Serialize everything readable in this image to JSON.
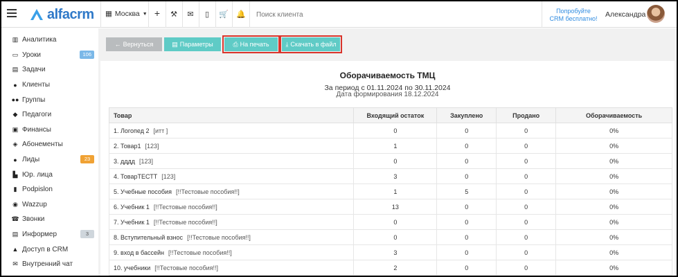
{
  "brand": {
    "name": "alfacrm"
  },
  "topbar": {
    "city": "Москва",
    "search_placeholder": "Поиск клиента",
    "promo_line1": "Попробуйте",
    "promo_line2": "CRM бесплатно!",
    "user_name": "Александра"
  },
  "sidebar": {
    "items": [
      {
        "label": "Аналитика",
        "icon": "chart-icon"
      },
      {
        "label": "Уроки",
        "icon": "calendar-icon",
        "badge": "106",
        "badge_color": "#7bb8e8"
      },
      {
        "label": "Задачи",
        "icon": "tasks-icon"
      },
      {
        "label": "Клиенты",
        "icon": "user-icon"
      },
      {
        "label": "Группы",
        "icon": "users-icon"
      },
      {
        "label": "Педагоги",
        "icon": "graduation-cap-icon"
      },
      {
        "label": "Финансы",
        "icon": "money-icon"
      },
      {
        "label": "Абонементы",
        "icon": "tag-icon"
      },
      {
        "label": "Лиды",
        "icon": "user-plus-icon",
        "badge": "23",
        "badge_color": "#f0a234"
      },
      {
        "label": "Юр. лица",
        "icon": "building-icon"
      },
      {
        "label": "Podpislon",
        "icon": "file-icon"
      },
      {
        "label": "Wazzup",
        "icon": "whatsapp-icon"
      },
      {
        "label": "Звонки",
        "icon": "phone-icon"
      },
      {
        "label": "Информер",
        "icon": "book-icon",
        "badge": "3",
        "badge_color": "#cfd6dc"
      },
      {
        "label": "Доступ в CRM",
        "icon": "lock-icon"
      },
      {
        "label": "Внутренний чат",
        "icon": "envelope-icon"
      }
    ]
  },
  "toolbar": {
    "back_label": "Вернуться",
    "params_label": "Параметры",
    "print_label": "На печать",
    "download_label": "Скачать в файл"
  },
  "report": {
    "title": "Оборачиваемость ТМЦ",
    "period": "За период с 01.11.2024 по 30.11.2024",
    "generated": "Дата формирования 18.12.2024",
    "columns": [
      "Товар",
      "Входящий остаток",
      "Закуплено",
      "Продано",
      "Оборачиваемость"
    ],
    "rows": [
      {
        "name": "1. Логопед 2",
        "cat": "[итт ]",
        "in": "0",
        "bought": "0",
        "sold": "0",
        "turn": "0%"
      },
      {
        "name": "2. Товар1",
        "cat": "[123]",
        "in": "1",
        "bought": "0",
        "sold": "0",
        "turn": "0%"
      },
      {
        "name": "3. дддд",
        "cat": "[123]",
        "in": "0",
        "bought": "0",
        "sold": "0",
        "turn": "0%"
      },
      {
        "name": "4. ТоварТЕСТТ",
        "cat": "[123]",
        "in": "3",
        "bought": "0",
        "sold": "0",
        "turn": "0%"
      },
      {
        "name": "5. Учебные пособия",
        "cat": "[!!Тестовые пособия!!]",
        "in": "1",
        "bought": "5",
        "sold": "0",
        "turn": "0%"
      },
      {
        "name": "6. Учебник 1",
        "cat": "[!!Тестовые пособия!!]",
        "in": "13",
        "bought": "0",
        "sold": "0",
        "turn": "0%"
      },
      {
        "name": "7. Учебник 1",
        "cat": "[!!Тестовые пособия!!]",
        "in": "0",
        "bought": "0",
        "sold": "0",
        "turn": "0%"
      },
      {
        "name": "8. Вступительный взнос",
        "cat": "[!!Тестовые пособия!!]",
        "in": "0",
        "bought": "0",
        "sold": "0",
        "turn": "0%"
      },
      {
        "name": "9. вход в бассейн",
        "cat": "[!!Тестовые пособия!!]",
        "in": "3",
        "bought": "0",
        "sold": "0",
        "turn": "0%"
      },
      {
        "name": "10. учебники",
        "cat": "[!!Тестовые пособия!!]",
        "in": "2",
        "bought": "0",
        "sold": "0",
        "turn": "0%"
      }
    ]
  },
  "colors": {
    "accent": "#5fcbc6",
    "brand": "#2f79c8",
    "highlight": "#d9342b"
  }
}
